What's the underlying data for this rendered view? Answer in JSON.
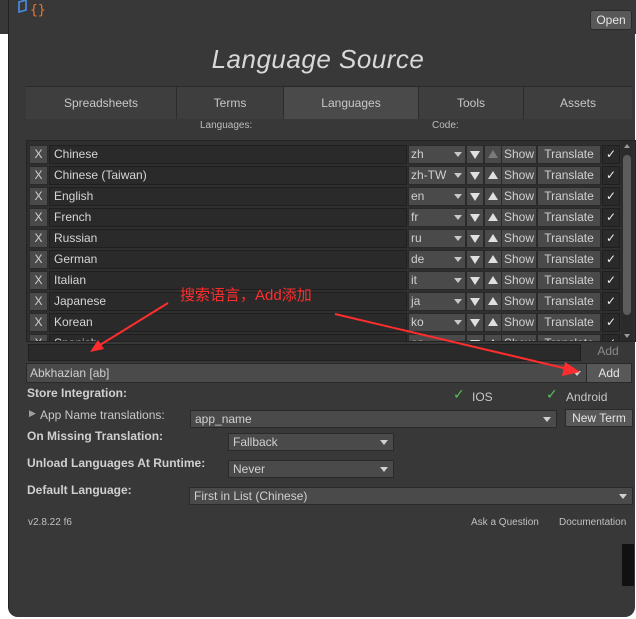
{
  "window": {
    "open_label": "Open",
    "title": "Language Source"
  },
  "tabs": [
    {
      "label": "Spreadsheets"
    },
    {
      "label": "Terms"
    },
    {
      "label": "Languages",
      "active": true
    },
    {
      "label": "Tools"
    },
    {
      "label": "Assets"
    }
  ],
  "headers": {
    "languages": "Languages:",
    "code": "Code:"
  },
  "languages": [
    {
      "remove": "X",
      "name": "Chinese",
      "code": "zh",
      "show": "Show",
      "translate": "Translate",
      "checked": "✓"
    },
    {
      "remove": "X",
      "name": "Chinese (Taiwan)",
      "code": "zh-TW",
      "show": "Show",
      "translate": "Translate",
      "checked": "✓"
    },
    {
      "remove": "X",
      "name": "English",
      "code": "en",
      "show": "Show",
      "translate": "Translate",
      "checked": "✓"
    },
    {
      "remove": "X",
      "name": "French",
      "code": "fr",
      "show": "Show",
      "translate": "Translate",
      "checked": "✓"
    },
    {
      "remove": "X",
      "name": "Russian",
      "code": "ru",
      "show": "Show",
      "translate": "Translate",
      "checked": "✓"
    },
    {
      "remove": "X",
      "name": "German",
      "code": "de",
      "show": "Show",
      "translate": "Translate",
      "checked": "✓"
    },
    {
      "remove": "X",
      "name": "Italian",
      "code": "it",
      "show": "Show",
      "translate": "Translate",
      "checked": "✓"
    },
    {
      "remove": "X",
      "name": "Japanese",
      "code": "ja",
      "show": "Show",
      "translate": "Translate",
      "checked": "✓"
    },
    {
      "remove": "X",
      "name": "Korean",
      "code": "ko",
      "show": "Show",
      "translate": "Translate",
      "checked": "✓"
    },
    {
      "remove": "X",
      "name": "Spanish",
      "code": "es",
      "show": "Show",
      "translate": "Translate",
      "checked": "✓"
    }
  ],
  "add_language": {
    "search_value": "",
    "add_disabled_label": "Add",
    "selected": "Abkhazian [ab]",
    "add_label": "Add"
  },
  "store_integration": {
    "label": "Store Integration:",
    "ios": "IOS",
    "android": "Android"
  },
  "app_name": {
    "label": "App Name translations:",
    "value": "app_name",
    "new_term": "New Term"
  },
  "missing_translation": {
    "label": "On Missing Translation:",
    "value": "Fallback"
  },
  "unload_languages": {
    "label": "Unload Languages At Runtime:",
    "value": "Never"
  },
  "default_language": {
    "label": "Default Language:",
    "value": "First in List (Chinese)"
  },
  "footer": {
    "version": "v2.8.22 f6",
    "ask": "Ask a Question",
    "docs": "Documentation"
  },
  "annotation": {
    "text": "搜索语言，Add添加",
    "color": "#ff2d2d"
  },
  "colors": {
    "panel_bg": "#383838",
    "field_bg": "#2a2a2a",
    "button_bg": "#4a4a4a",
    "check_green": "#56c25a"
  }
}
